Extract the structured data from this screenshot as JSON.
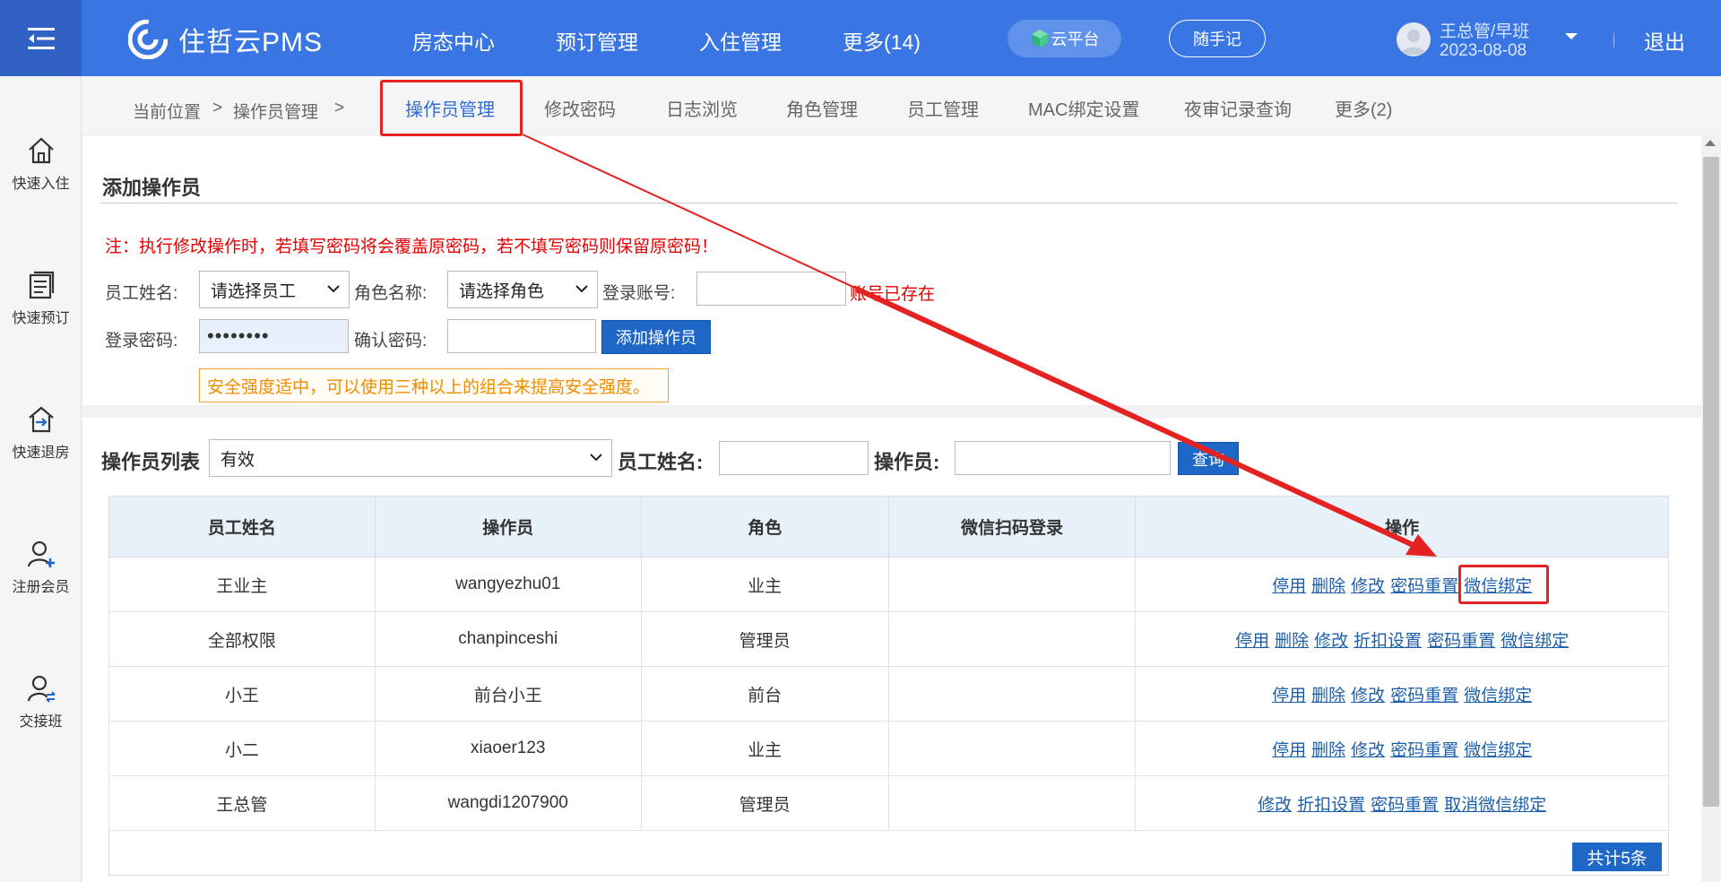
{
  "topbar": {
    "logo_text": "住哲云PMS",
    "nav": [
      "房态中心",
      "预订管理",
      "入住管理",
      "更多(14)"
    ],
    "cloud_platform": "云平台",
    "notes": "随手记",
    "user_name": "王总管/早班",
    "user_date": "2023-08-08",
    "logout": "退出"
  },
  "sidebar": {
    "items": [
      "快速入住",
      "快速预订",
      "快速退房",
      "注册会员",
      "交接班"
    ]
  },
  "breadcrumb": {
    "location": "当前位置",
    "sep": ">",
    "section": "操作员管理"
  },
  "tabs": [
    "操作员管理",
    "修改密码",
    "日志浏览",
    "角色管理",
    "员工管理",
    "MAC绑定设置",
    "夜审记录查询",
    "更多(2)"
  ],
  "add_form": {
    "title": "添加操作员",
    "warning": "注：执行修改操作时，若填写密码将会覆盖原密码，若不填写密码则保留原密码！",
    "employee_label": "员工姓名:",
    "employee_select": "请选择员工",
    "role_label": "角色名称:",
    "role_select": "请选择角色",
    "account_label": "登录账号:",
    "account_exists": "账号已存在",
    "password_label": "登录密码:",
    "password_value": "••••••••",
    "confirm_label": "确认密码:",
    "add_button": "添加操作员",
    "strength_tip": "安全强度适中，可以使用三种以上的组合来提高安全强度。"
  },
  "list": {
    "title": "操作员列表",
    "status_select": "有效",
    "employee_label": "员工姓名:",
    "operator_label": "操作员:",
    "query_button": "查询",
    "columns": [
      "员工姓名",
      "操作员",
      "角色",
      "微信扫码登录",
      "操作"
    ],
    "rows": [
      {
        "name": "王业主",
        "operator": "wangyezhu01",
        "role": "业主",
        "wechat": "",
        "ops": [
          "停用",
          "删除",
          "修改",
          "密码重置",
          "微信绑定"
        ]
      },
      {
        "name": "全部权限",
        "operator": "chanpinceshi",
        "role": "管理员",
        "wechat": "",
        "ops": [
          "停用",
          "删除",
          "修改",
          "折扣设置",
          "密码重置",
          "微信绑定"
        ]
      },
      {
        "name": "小王",
        "operator": "前台小王",
        "role": "前台",
        "wechat": "",
        "ops": [
          "停用",
          "删除",
          "修改",
          "密码重置",
          "微信绑定"
        ]
      },
      {
        "name": "小二",
        "operator": "xiaoer123",
        "role": "业主",
        "wechat": "",
        "ops": [
          "停用",
          "删除",
          "修改",
          "密码重置",
          "微信绑定"
        ]
      },
      {
        "name": "王总管",
        "operator": "wangdi1207900",
        "role": "管理员",
        "wechat": "",
        "ops": [
          "修改",
          "折扣设置",
          "密码重置",
          "取消微信绑定"
        ]
      }
    ],
    "total": "共计5条"
  },
  "colors": {
    "primary": "#3a76e3",
    "annotation": "#e52222",
    "warning_text": "#e60000",
    "link": "#1d5fa8"
  }
}
